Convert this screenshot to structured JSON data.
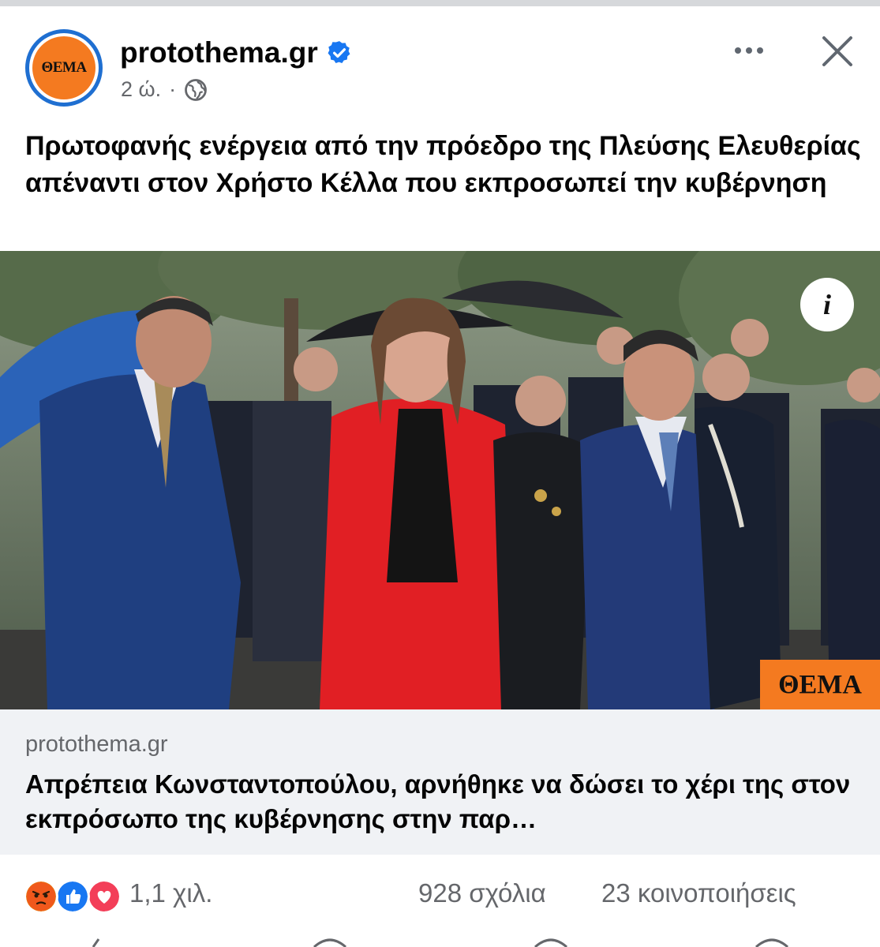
{
  "post": {
    "page_name": "protothema.gr",
    "avatar_logo_text": "ΘΕΜΑ",
    "time": "2 ώ.",
    "separator": "·",
    "text": "Πρωτοφανής ενέργεια από την πρόεδρο της Πλεύσης Ελευθερίας απέναντι στον Χρήστο Κέλλα που εκπροσωπεί την κυβέρνηση",
    "photo_watermark": "ΘΕΜΑ",
    "info_label": "i"
  },
  "link_preview": {
    "domain": "protothema.gr",
    "title": "Απρέπεια Κωνσταντοπούλου, αρνήθηκε να δώσει το χέρι της στον εκπρόσωπο της κυβέρνησης στην παρ…"
  },
  "stats": {
    "reactions_count": "1,1 χιλ.",
    "comments": "928 σχόλια",
    "shares": "23 κοινοποιήσεις"
  },
  "icons": {
    "verified": "verified-badge-icon",
    "globe": "globe-icon",
    "more": "more-icon",
    "close": "close-icon",
    "reactions": [
      "angry-reaction-icon",
      "like-reaction-icon",
      "love-reaction-icon"
    ]
  },
  "colors": {
    "brand_orange": "#f47a20",
    "verified_blue": "#1877f2",
    "text_secondary": "#65676b",
    "link_bg": "#f0f2f5"
  }
}
